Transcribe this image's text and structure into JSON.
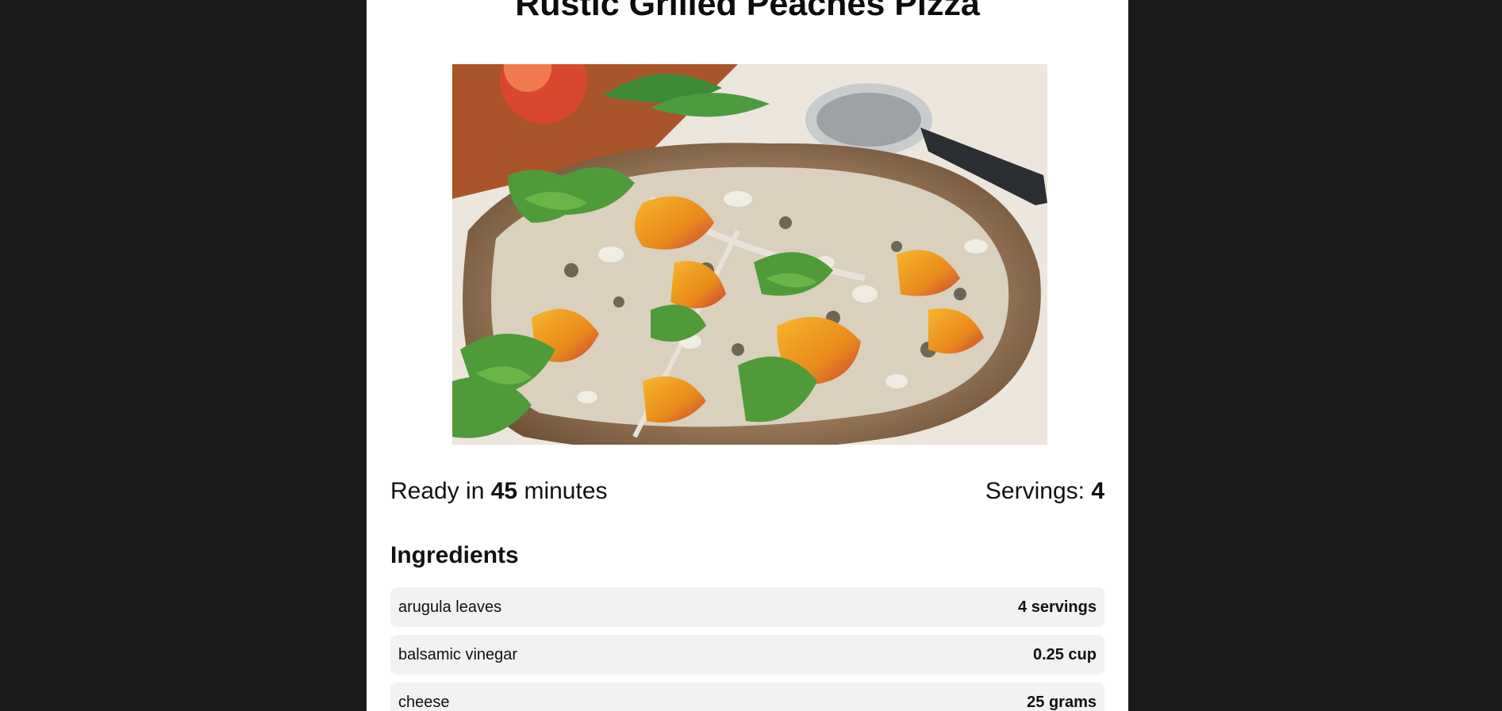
{
  "recipe": {
    "title": "Rustic Grilled Peaches Pizza",
    "image_alt": "Grilled peach pizza with arugula and cheese",
    "ready_prefix": "Ready in",
    "ready_minutes": "45",
    "ready_suffix": "minutes",
    "servings_label": "Servings:",
    "servings_value": "4"
  },
  "ingredients": {
    "heading": "Ingredients",
    "items": [
      {
        "name": "arugula leaves",
        "amount": "4 servings"
      },
      {
        "name": "balsamic vinegar",
        "amount": "0.25 cup"
      },
      {
        "name": "cheese",
        "amount": "25 grams"
      }
    ]
  },
  "colors": {
    "outer_background": "#1a1a1b",
    "page_background": "#ffffff",
    "ingredient_row_background": "#f1f2f4",
    "text": "#111111"
  }
}
